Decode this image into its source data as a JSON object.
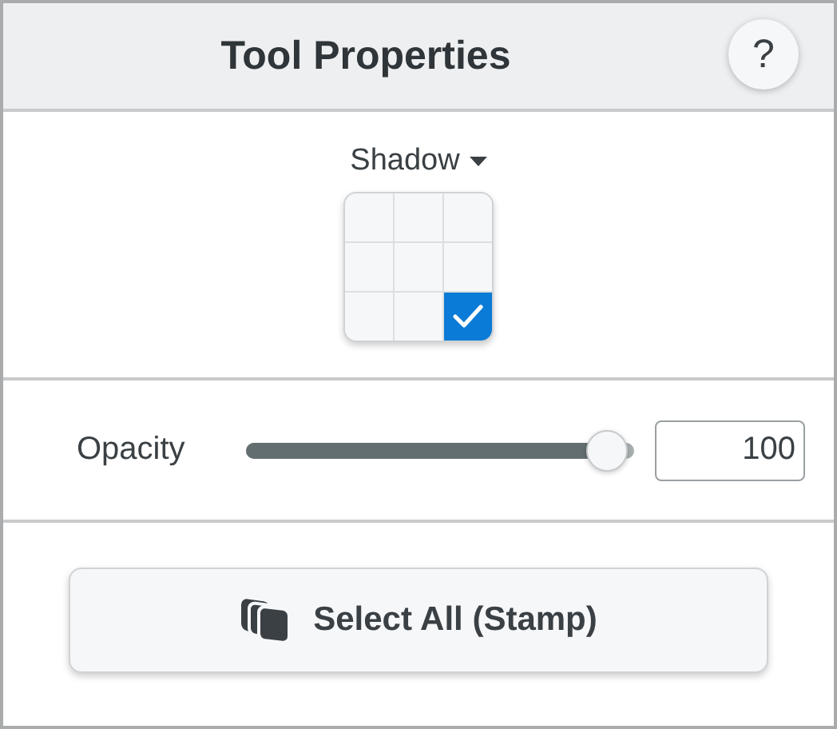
{
  "header": {
    "title": "Tool Properties",
    "help": "?"
  },
  "shadow": {
    "label": "Shadow",
    "positions": [
      {
        "selected": false
      },
      {
        "selected": false
      },
      {
        "selected": false
      },
      {
        "selected": false
      },
      {
        "selected": false
      },
      {
        "selected": false
      },
      {
        "selected": false
      },
      {
        "selected": false
      },
      {
        "selected": true
      }
    ]
  },
  "opacity": {
    "label": "Opacity",
    "level": 0.93,
    "value": "100"
  },
  "button": {
    "label": "Select All (Stamp)"
  }
}
